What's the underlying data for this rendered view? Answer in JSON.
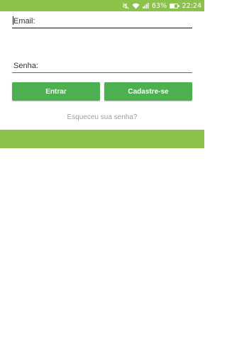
{
  "status_bar": {
    "battery_percent": "63%",
    "battery_level": 0.63,
    "time": "22:24",
    "icons": [
      "mute-icon",
      "wifi-icon",
      "signal-icon",
      "battery-icon"
    ]
  },
  "form": {
    "email_placeholder": "Email:",
    "email_value": "",
    "password_placeholder": "Senha:",
    "password_value": ""
  },
  "buttons": {
    "login_label": "Entrar",
    "register_label": "Cadastre-se"
  },
  "forgot_password_label": "Esqueceu sua senha?",
  "colors": {
    "status_bar": "#8bc34a",
    "button": "#4caf50",
    "band": "#8bc34a",
    "muted_text": "#9e9e9e"
  }
}
